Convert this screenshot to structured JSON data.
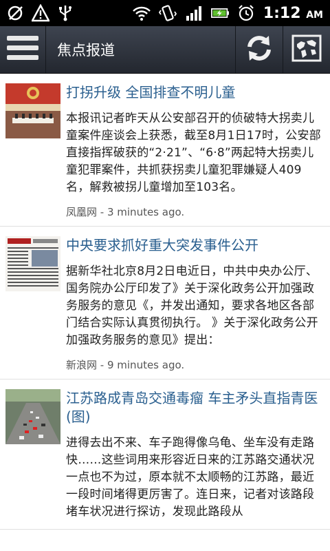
{
  "status": {
    "time": "1:12",
    "ampm": "AM"
  },
  "header": {
    "title": "焦点报道"
  },
  "articles": [
    {
      "title": "打拐升级 全国排查不明儿童",
      "summary": "本报讯记者昨天从公安部召开的侦破特大拐卖儿童案件座谈会上获悉，截至8月1日17时，公安部直接指挥破获的“2·21”、“6·8”两起特大拐卖儿童犯罪案件，共抓获拐卖儿童犯罪嫌疑人409名，解救被拐儿童增加至103名。",
      "source": "凤凰网",
      "time_ago": "3 minutes ago."
    },
    {
      "title": "中央要求抓好重大突发事件公开",
      "summary": "据新华社北京8月2日电近日，中共中央办公厅、国务院办公厅印发了》关于深化政务公开加强政务服务的意见《，并发出通知，要求各地区各部门结合实际认真贯彻执行。 》关于深化政务公开加强政务服务的意见》提出：",
      "source": "新浪网",
      "time_ago": "9 minutes ago."
    },
    {
      "title": "江苏路成青岛交通毒瘤 车主矛头直指青医(图)",
      "summary": "进得去出不来、车子跑得像乌龟、坐车没有走路快……这些词用来形容近日来的江苏路交通状况一点也不为过，原本就不太顺畅的江苏路，最近一段时间堵得更厉害了。连日来，记者对该路段堵车状况进行探访，发现此路段从",
      "source": "",
      "time_ago": ""
    }
  ],
  "meta_separator": " - "
}
